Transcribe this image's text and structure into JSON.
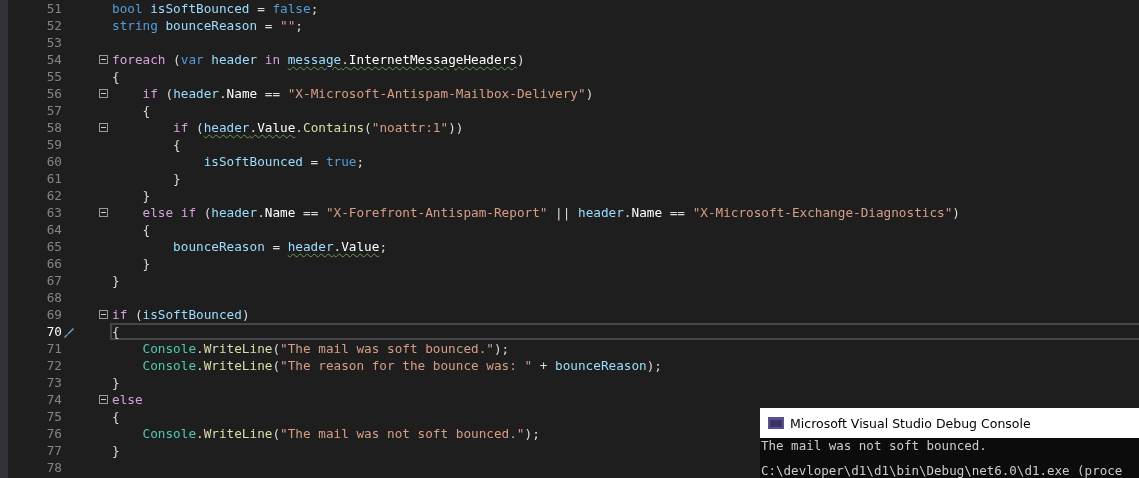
{
  "editor": {
    "lines": [
      {
        "number": "51",
        "foldable": false,
        "current": false,
        "tokens": [
          {
            "kind": "keyword",
            "text": "bool"
          },
          {
            "kind": "variable",
            "text": " isSoftBounced"
          },
          {
            "kind": "plain",
            "text": " = "
          },
          {
            "kind": "keyword",
            "text": "false"
          },
          {
            "kind": "plain",
            "text": ";"
          }
        ]
      },
      {
        "number": "52",
        "foldable": false,
        "current": false,
        "tokens": [
          {
            "kind": "keyword",
            "text": "string"
          },
          {
            "kind": "variable",
            "text": " bounceReason"
          },
          {
            "kind": "plain",
            "text": " = "
          },
          {
            "kind": "string",
            "text": "\"\""
          },
          {
            "kind": "plain",
            "text": ";"
          }
        ]
      },
      {
        "number": "53",
        "foldable": false,
        "current": false
      },
      {
        "number": "54",
        "foldable": true,
        "current": false,
        "tokens": [
          {
            "kind": "control",
            "text": "foreach"
          },
          {
            "kind": "plain",
            "text": " ("
          },
          {
            "kind": "keyword",
            "text": "var"
          },
          {
            "kind": "variable",
            "text": " header"
          },
          {
            "kind": "control",
            "text": " in "
          },
          {
            "kind": "variable",
            "text": "message",
            "squiggle": true
          },
          {
            "kind": "plain",
            "text": ".",
            "squiggle": true
          },
          {
            "kind": "property",
            "text": "InternetMessageHeaders",
            "squiggle": true
          },
          {
            "kind": "plain",
            "text": ")"
          }
        ]
      },
      {
        "number": "55",
        "foldable": false,
        "current": false,
        "tokens": [
          {
            "kind": "plain",
            "text": "{"
          }
        ]
      },
      {
        "number": "56",
        "foldable": true,
        "current": false,
        "tokens": [
          {
            "kind": "control",
            "text": "    if"
          },
          {
            "kind": "plain",
            "text": " ("
          },
          {
            "kind": "variable",
            "text": "header"
          },
          {
            "kind": "plain",
            "text": "."
          },
          {
            "kind": "property",
            "text": "Name"
          },
          {
            "kind": "plain",
            "text": " == "
          },
          {
            "kind": "string",
            "text": "\"X-Microsoft-Antispam-Mailbox-Delivery\""
          },
          {
            "kind": "plain",
            "text": ")"
          }
        ]
      },
      {
        "number": "57",
        "foldable": false,
        "current": false,
        "tokens": [
          {
            "kind": "plain",
            "text": "    {"
          }
        ]
      },
      {
        "number": "58",
        "foldable": true,
        "current": false,
        "tokens": [
          {
            "kind": "control",
            "text": "        if"
          },
          {
            "kind": "plain",
            "text": " ("
          },
          {
            "kind": "variable",
            "text": "header",
            "squiggle": true
          },
          {
            "kind": "plain",
            "text": ".",
            "squiggle": true
          },
          {
            "kind": "property",
            "text": "Value",
            "squiggle": true
          },
          {
            "kind": "plain",
            "text": "."
          },
          {
            "kind": "method",
            "text": "Contains"
          },
          {
            "kind": "plain",
            "text": "("
          },
          {
            "kind": "string",
            "text": "\"noattr:1\""
          },
          {
            "kind": "plain",
            "text": "))"
          }
        ]
      },
      {
        "number": "59",
        "foldable": false,
        "current": false,
        "tokens": [
          {
            "kind": "plain",
            "text": "        {"
          }
        ]
      },
      {
        "number": "60",
        "foldable": false,
        "current": false,
        "tokens": [
          {
            "kind": "variable",
            "text": "            isSoftBounced"
          },
          {
            "kind": "plain",
            "text": " = "
          },
          {
            "kind": "keyword",
            "text": "true"
          },
          {
            "kind": "plain",
            "text": ";"
          }
        ]
      },
      {
        "number": "61",
        "foldable": false,
        "current": false,
        "tokens": [
          {
            "kind": "plain",
            "text": "        }"
          }
        ]
      },
      {
        "number": "62",
        "foldable": false,
        "current": false,
        "tokens": [
          {
            "kind": "plain",
            "text": "    }"
          }
        ]
      },
      {
        "number": "63",
        "foldable": true,
        "current": false,
        "tokens": [
          {
            "kind": "control",
            "text": "    else if"
          },
          {
            "kind": "plain",
            "text": " ("
          },
          {
            "kind": "variable",
            "text": "header"
          },
          {
            "kind": "plain",
            "text": "."
          },
          {
            "kind": "property",
            "text": "Name"
          },
          {
            "kind": "plain",
            "text": " == "
          },
          {
            "kind": "string",
            "text": "\"X-Forefront-Antispam-Report\""
          },
          {
            "kind": "plain",
            "text": " || "
          },
          {
            "kind": "variable",
            "text": "header"
          },
          {
            "kind": "plain",
            "text": "."
          },
          {
            "kind": "property",
            "text": "Name"
          },
          {
            "kind": "plain",
            "text": " == "
          },
          {
            "kind": "string",
            "text": "\"X-Microsoft-Exchange-Diagnostics\""
          },
          {
            "kind": "plain",
            "text": ")"
          }
        ]
      },
      {
        "number": "64",
        "foldable": false,
        "current": false,
        "tokens": [
          {
            "kind": "plain",
            "text": "    {"
          }
        ]
      },
      {
        "number": "65",
        "foldable": false,
        "current": false,
        "tokens": [
          {
            "kind": "variable",
            "text": "        bounceReason"
          },
          {
            "kind": "plain",
            "text": " = "
          },
          {
            "kind": "variable",
            "text": "header",
            "squiggle": true
          },
          {
            "kind": "plain",
            "text": ".",
            "squiggle": true
          },
          {
            "kind": "property",
            "text": "Value",
            "squiggle": true
          },
          {
            "kind": "plain",
            "text": ";"
          }
        ]
      },
      {
        "number": "66",
        "foldable": false,
        "current": false,
        "tokens": [
          {
            "kind": "plain",
            "text": "    }"
          }
        ]
      },
      {
        "number": "67",
        "foldable": false,
        "current": false,
        "tokens": [
          {
            "kind": "plain",
            "text": "}"
          }
        ]
      },
      {
        "number": "68",
        "foldable": false,
        "current": false
      },
      {
        "number": "69",
        "foldable": true,
        "current": false,
        "tokens": [
          {
            "kind": "control",
            "text": "if"
          },
          {
            "kind": "plain",
            "text": " ("
          },
          {
            "kind": "variable",
            "text": "isSoftBounced"
          },
          {
            "kind": "plain",
            "text": ")"
          }
        ]
      },
      {
        "number": "70",
        "foldable": false,
        "current": true,
        "tokens": [
          {
            "kind": "plain",
            "text": "{"
          }
        ]
      },
      {
        "number": "71",
        "foldable": false,
        "current": false,
        "tokens": [
          {
            "kind": "class",
            "text": "    Console"
          },
          {
            "kind": "plain",
            "text": "."
          },
          {
            "kind": "method",
            "text": "WriteLine"
          },
          {
            "kind": "plain",
            "text": "("
          },
          {
            "kind": "string",
            "text": "\"The mail was soft bounced.\""
          },
          {
            "kind": "plain",
            "text": ");"
          }
        ]
      },
      {
        "number": "72",
        "foldable": false,
        "current": false,
        "tokens": [
          {
            "kind": "class",
            "text": "    Console"
          },
          {
            "kind": "plain",
            "text": "."
          },
          {
            "kind": "method",
            "text": "WriteLine"
          },
          {
            "kind": "plain",
            "text": "("
          },
          {
            "kind": "string",
            "text": "\"The reason for the bounce was: \""
          },
          {
            "kind": "plain",
            "text": " + "
          },
          {
            "kind": "variable",
            "text": "bounceReason"
          },
          {
            "kind": "plain",
            "text": ");"
          }
        ]
      },
      {
        "number": "73",
        "foldable": false,
        "current": false,
        "tokens": [
          {
            "kind": "plain",
            "text": "}"
          }
        ]
      },
      {
        "number": "74",
        "foldable": true,
        "current": false,
        "tokens": [
          {
            "kind": "control",
            "text": "else"
          }
        ]
      },
      {
        "number": "75",
        "foldable": false,
        "current": false,
        "tokens": [
          {
            "kind": "plain",
            "text": "{"
          }
        ]
      },
      {
        "number": "76",
        "foldable": false,
        "current": false,
        "tokens": [
          {
            "kind": "class",
            "text": "    Console"
          },
          {
            "kind": "plain",
            "text": "."
          },
          {
            "kind": "method",
            "text": "WriteLine"
          },
          {
            "kind": "plain",
            "text": "("
          },
          {
            "kind": "string",
            "text": "\"The mail was not soft bounced.\""
          },
          {
            "kind": "plain",
            "text": ");"
          }
        ]
      },
      {
        "number": "77",
        "foldable": false,
        "current": false,
        "tokens": [
          {
            "kind": "plain",
            "text": "}"
          }
        ]
      },
      {
        "number": "78",
        "foldable": false,
        "current": false
      }
    ]
  },
  "console": {
    "title": "Microsoft Visual Studio Debug Console",
    "lines": [
      "The mail was not soft bounced.",
      "C:\\devloper\\d1\\d1\\bin\\Debug\\net6.0\\d1.exe (proce"
    ]
  }
}
